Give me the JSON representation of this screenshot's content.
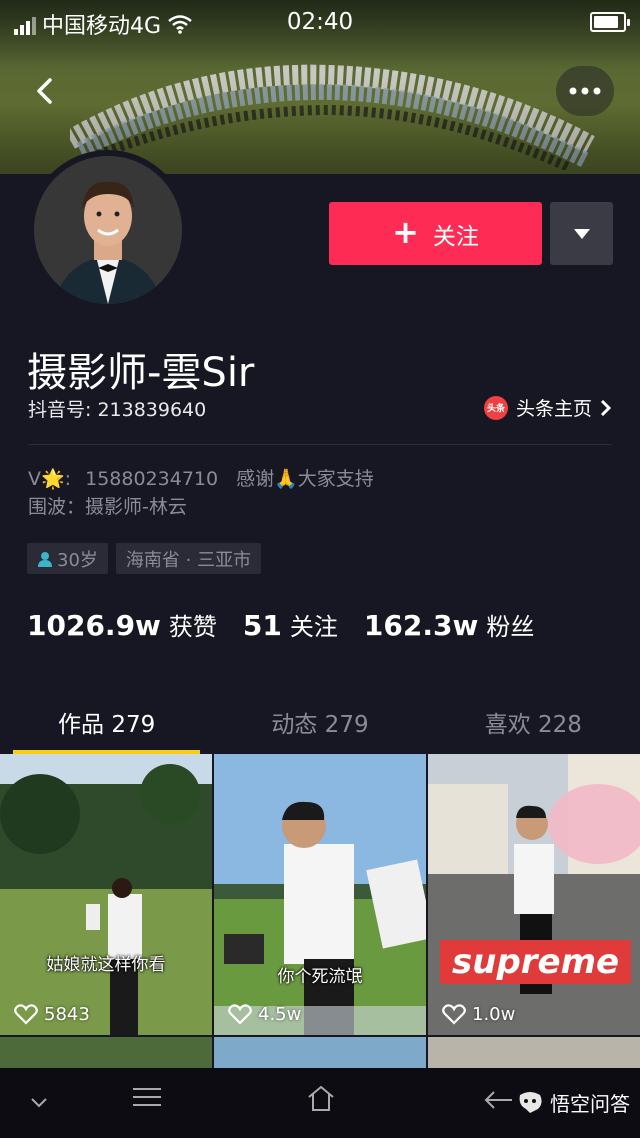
{
  "status_bar": {
    "carrier": "中国移动4G",
    "time": "02:40",
    "battery_level": 0.85
  },
  "profile": {
    "username": "摄影师-雲Sir",
    "douyin_id_label": "抖音号: 213839640",
    "toutiao_logo_text": "头条",
    "toutiao_link": "头条主页",
    "bio_line1_prefix": "V🌟:",
    "bio_line1_phone": "15880234710",
    "bio_line1_suffix": "感谢🙏大家支持",
    "bio_line2": "围波：摄影师-林云",
    "tags": [
      "30岁",
      "海南省 · 三亚市"
    ],
    "stats": [
      {
        "num": "1026.9w",
        "label": "获赞"
      },
      {
        "num": "51",
        "label": "关注"
      },
      {
        "num": "162.3w",
        "label": "粉丝"
      }
    ]
  },
  "actions": {
    "follow_plus": "+",
    "follow_label": "关注"
  },
  "tabs": [
    {
      "label": "作品 279",
      "active": true
    },
    {
      "label": "动态 279",
      "active": false
    },
    {
      "label": "喜欢 228",
      "active": false
    }
  ],
  "videos": [
    {
      "caption": "姑娘就这样你看",
      "likes": "5843"
    },
    {
      "caption": "你个死流氓",
      "likes": "4.5w"
    },
    {
      "caption": "supreme",
      "likes": "1.0w"
    }
  ],
  "watermark": "悟空问答",
  "colors": {
    "accent": "#fe2c55",
    "tab_indicator": "#face15",
    "background": "#161722"
  },
  "icons": [
    "back-arrow-icon",
    "more-dots-icon",
    "chevron-down-icon",
    "heart-icon",
    "person-icon",
    "chevron-right-icon",
    "menu-icon",
    "home-icon",
    "back-nav-icon"
  ]
}
